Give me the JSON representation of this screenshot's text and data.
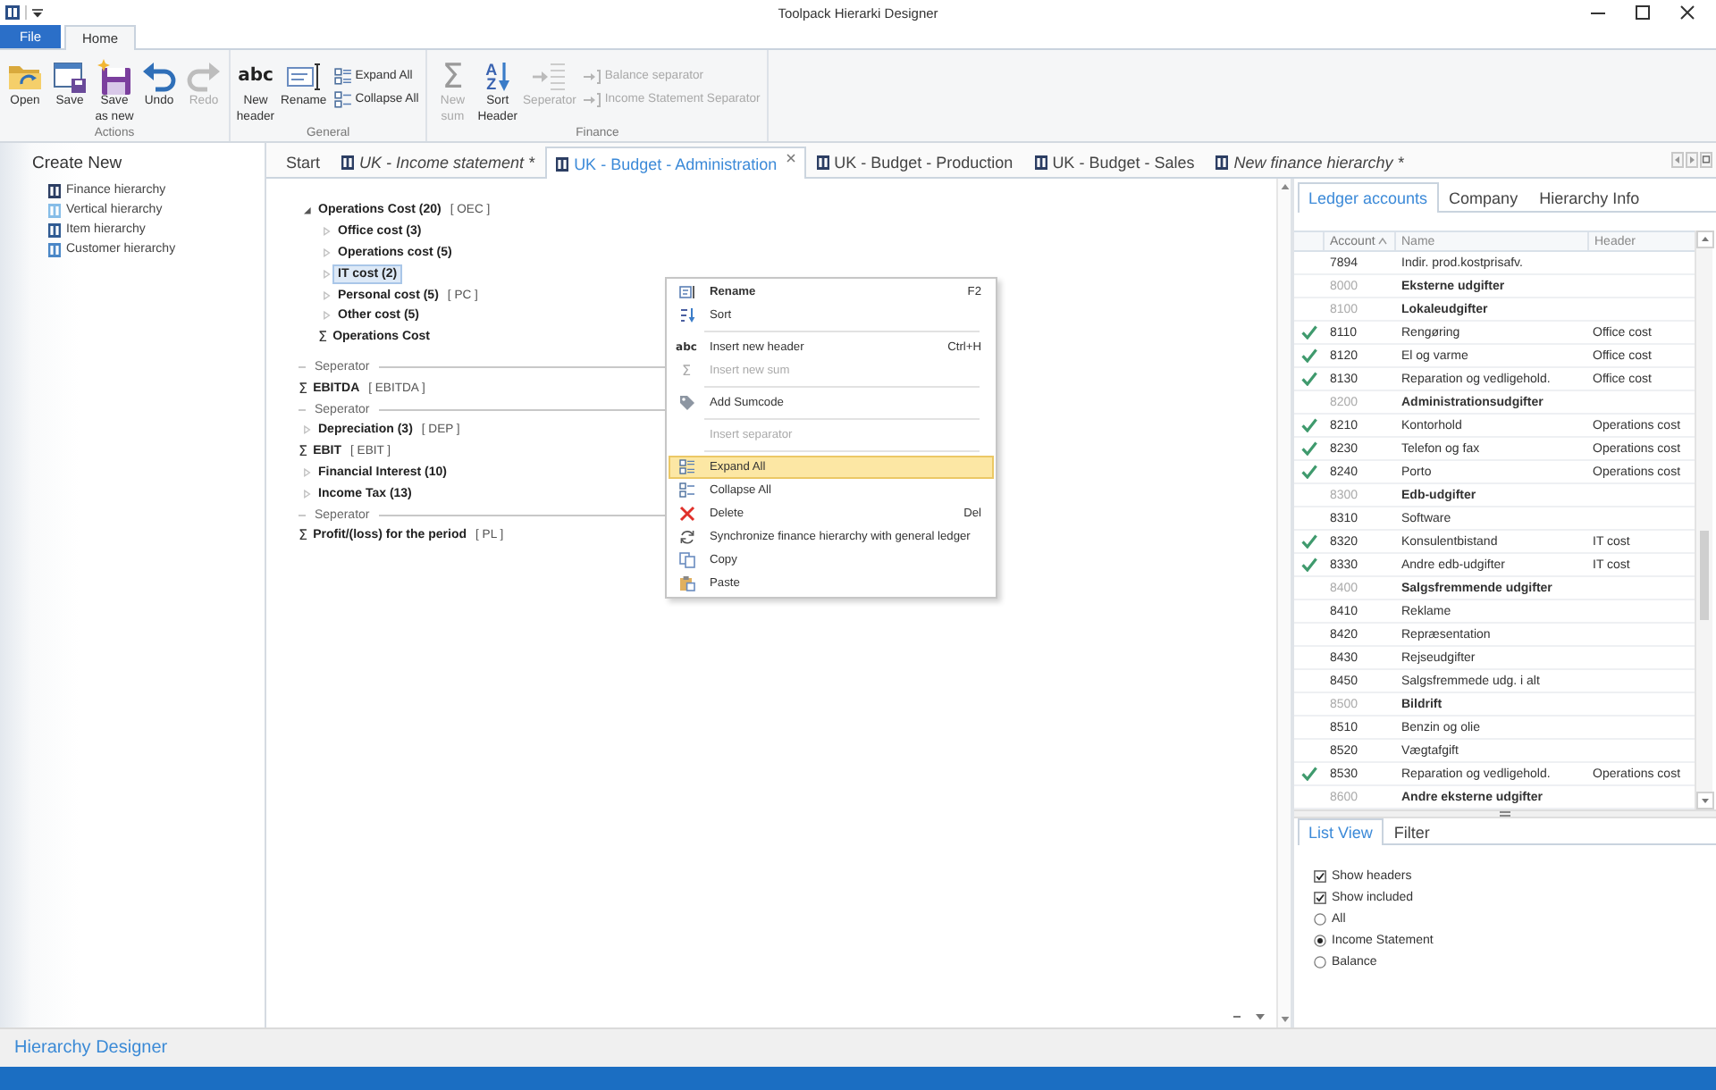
{
  "window": {
    "title": "Toolpack Hierarki Designer"
  },
  "ribbon": {
    "tabs": [
      {
        "label": "File",
        "kind": "file",
        "selected": false
      },
      {
        "label": "Home",
        "kind": "tab",
        "selected": true
      }
    ],
    "groups": [
      {
        "label": "Actions",
        "buttons": [
          {
            "kind": "open",
            "label": "Open",
            "disabled": false
          },
          {
            "kind": "save",
            "label": "Save",
            "disabled": false
          },
          {
            "kind": "saveas",
            "label": "Save\nas new",
            "disabled": false
          },
          {
            "kind": "undo",
            "label": "Undo",
            "disabled": false
          },
          {
            "kind": "redo",
            "label": "Redo",
            "disabled": true
          }
        ]
      },
      {
        "label": "General",
        "buttons": [
          {
            "kind": "header",
            "glyph": "abc",
            "label": "New\nheader",
            "disabled": false
          },
          {
            "kind": "rename",
            "label": "Rename",
            "disabled": false
          },
          {
            "kind": "expand",
            "label": "Expand All",
            "disabled": false
          },
          {
            "kind": "collapse",
            "label": "Collapse All",
            "disabled": false
          }
        ]
      },
      {
        "label": "Finance",
        "buttons": [
          {
            "kind": "sum",
            "glyph": "Σ",
            "label": "New\nsum",
            "disabled": true
          },
          {
            "kind": "sort",
            "glyph": "AZ",
            "label": "Sort\nHeader",
            "disabled": false
          },
          {
            "kind": "separator",
            "label": "Seperator",
            "disabled": true
          },
          {
            "kind": "balance",
            "label": "Balance separator",
            "disabled": true
          },
          {
            "kind": "statement",
            "label": "Income Statement Separator",
            "disabled": true
          }
        ]
      }
    ]
  },
  "sidebar": {
    "title": "Create New",
    "items": [
      {
        "label": "Finance hierarchy",
        "color": "#2c3e63"
      },
      {
        "label": "Vertical hierarchy",
        "color": "#86bde8"
      },
      {
        "label": "Item hierarchy",
        "color": "#2f5b93"
      },
      {
        "label": "Customer hierarchy",
        "color": "#4a87c7"
      }
    ]
  },
  "document_tabs": [
    {
      "kind": "start",
      "label": "Start",
      "selected": false,
      "unsaved": false
    },
    {
      "kind": "document",
      "label": "UK - Income statement *",
      "selected": false,
      "unsaved": true
    },
    {
      "kind": "document",
      "label": "UK - Budget - Administration",
      "selected": true,
      "unsaved": false
    },
    {
      "kind": "document",
      "label": "UK - Budget - Production",
      "selected": false,
      "unsaved": false
    },
    {
      "kind": "document",
      "label": "UK - Budget - Sales",
      "selected": false,
      "unsaved": false
    },
    {
      "kind": "document",
      "label": "New finance hierarchy *",
      "selected": false,
      "unsaved": true
    }
  ],
  "tree": [
    {
      "kind": "group",
      "label": "Operations Cost (20)",
      "code": "[ OEC ]",
      "expanded": true,
      "selected": false,
      "children": [
        {
          "kind": "group",
          "label": "Office cost (3)",
          "expanded": false,
          "selected": false
        },
        {
          "kind": "group",
          "label": "Operations cost (5)",
          "expanded": false,
          "selected": false
        },
        {
          "kind": "group",
          "label": "IT cost (2)",
          "expanded": false,
          "selected": true
        },
        {
          "kind": "group",
          "label": "Personal cost (5)",
          "code": "[ PC ]",
          "expanded": false,
          "selected": false
        },
        {
          "kind": "group",
          "label": "Other cost (5)",
          "expanded": false,
          "selected": false
        },
        {
          "kind": "sum",
          "symbol": "Σ",
          "label": "Operations Cost",
          "selected": false
        }
      ]
    },
    {
      "kind": "separator",
      "label": "Seperator",
      "selected": false
    },
    {
      "kind": "sum",
      "symbol": "Σ",
      "label": "EBITDA",
      "code": "[ EBITDA ]",
      "selected": false
    },
    {
      "kind": "separator",
      "label": "Seperator",
      "selected": false
    },
    {
      "kind": "group",
      "label": "Depreciation (3)",
      "code": "[ DEP ]",
      "expanded": false,
      "selected": false
    },
    {
      "kind": "sum",
      "symbol": "Σ",
      "label": "EBIT",
      "code": "[ EBIT ]",
      "selected": false
    },
    {
      "kind": "group",
      "label": "Financial Interest (10)",
      "expanded": false,
      "selected": false
    },
    {
      "kind": "group",
      "label": "Income Tax (13)",
      "expanded": false,
      "selected": false
    },
    {
      "kind": "separator",
      "label": "Seperator",
      "selected": false
    },
    {
      "kind": "sum",
      "symbol": "Σ",
      "label": "Profit/(loss) for the period",
      "code": "[ PL ]",
      "selected": false
    }
  ],
  "context_menu": [
    {
      "kind": "rename",
      "label": "Rename",
      "shortcut": "F2",
      "default": true,
      "disabled": false,
      "selected": false
    },
    {
      "kind": "sort",
      "label": "Sort",
      "default": false,
      "disabled": false,
      "selected": false
    },
    {
      "kind": "divider"
    },
    {
      "kind": "header",
      "glyph": "abc",
      "label": "Insert new header",
      "shortcut": "Ctrl+H",
      "default": false,
      "disabled": false,
      "selected": false
    },
    {
      "kind": "sum",
      "glyph": "Σ",
      "label": "Insert new sum",
      "default": false,
      "disabled": true,
      "selected": false
    },
    {
      "kind": "divider"
    },
    {
      "kind": "sumcode",
      "label": "Add Sumcode",
      "default": false,
      "disabled": false,
      "selected": false
    },
    {
      "kind": "divider"
    },
    {
      "kind": "blank",
      "label": "Insert separator",
      "default": false,
      "disabled": true,
      "selected": false
    },
    {
      "kind": "divider"
    },
    {
      "kind": "expand",
      "label": "Expand All",
      "default": false,
      "disabled": false,
      "selected": true
    },
    {
      "kind": "collapse",
      "label": "Collapse All",
      "default": false,
      "disabled": false,
      "selected": false
    },
    {
      "kind": "delete",
      "label": "Delete",
      "shortcut": "Del",
      "default": false,
      "disabled": false,
      "selected": false
    },
    {
      "kind": "sync",
      "label": "Synchronize finance hierarchy with general ledger",
      "default": false,
      "disabled": false,
      "selected": false
    },
    {
      "kind": "copy",
      "label": "Copy",
      "default": false,
      "disabled": false,
      "selected": false
    },
    {
      "kind": "paste",
      "label": "Paste",
      "default": false,
      "disabled": false,
      "selected": false
    }
  ],
  "ledger_panel": {
    "tabs": [
      {
        "label": "Ledger accounts",
        "selected": true
      },
      {
        "label": "Company",
        "selected": false
      },
      {
        "label": "Hierarchy Info",
        "selected": false
      }
    ],
    "columns": [
      {
        "label": "Account",
        "sorted": true
      },
      {
        "label": "Name",
        "sorted": false
      },
      {
        "label": "Header",
        "sorted": false
      }
    ],
    "rows": [
      {
        "account": "7894",
        "name": "Indir. prod.kostprisafv.",
        "kind": "account",
        "included": false
      },
      {
        "account": "8000",
        "name": "Eksterne udgifter",
        "kind": "header",
        "included": false
      },
      {
        "account": "8100",
        "name": "Lokaleudgifter",
        "kind": "header",
        "included": false
      },
      {
        "account": "8110",
        "name": "Rengøring",
        "header": "Office cost",
        "kind": "account",
        "included": true
      },
      {
        "account": "8120",
        "name": "El og varme",
        "header": "Office cost",
        "kind": "account",
        "included": true
      },
      {
        "account": "8130",
        "name": "Reparation og vedligehold.",
        "header": "Office cost",
        "kind": "account",
        "included": true
      },
      {
        "account": "8200",
        "name": "Administrationsudgifter",
        "kind": "header",
        "included": false
      },
      {
        "account": "8210",
        "name": "Kontorhold",
        "header": "Operations cost",
        "kind": "account",
        "included": true
      },
      {
        "account": "8230",
        "name": "Telefon og fax",
        "header": "Operations cost",
        "kind": "account",
        "included": true
      },
      {
        "account": "8240",
        "name": "Porto",
        "header": "Operations cost",
        "kind": "account",
        "included": true
      },
      {
        "account": "8300",
        "name": "Edb-udgifter",
        "kind": "header",
        "included": false
      },
      {
        "account": "8310",
        "name": "Software",
        "kind": "account",
        "included": false
      },
      {
        "account": "8320",
        "name": "Konsulentbistand",
        "header": "IT cost",
        "kind": "account",
        "included": true
      },
      {
        "account": "8330",
        "name": "Andre edb-udgifter",
        "header": "IT cost",
        "kind": "account",
        "included": true
      },
      {
        "account": "8400",
        "name": "Salgsfremmende udgifter",
        "kind": "header",
        "included": false
      },
      {
        "account": "8410",
        "name": "Reklame",
        "kind": "account",
        "included": false
      },
      {
        "account": "8420",
        "name": "Repræsentation",
        "kind": "account",
        "included": false
      },
      {
        "account": "8430",
        "name": "Rejseudgifter",
        "kind": "account",
        "included": false
      },
      {
        "account": "8450",
        "name": "Salgsfremmede udg. i alt",
        "kind": "account",
        "included": false
      },
      {
        "account": "8500",
        "name": "Bildrift",
        "kind": "header",
        "included": false
      },
      {
        "account": "8510",
        "name": "Benzin og olie",
        "kind": "account",
        "included": false
      },
      {
        "account": "8520",
        "name": "Vægtafgift",
        "kind": "account",
        "included": false
      },
      {
        "account": "8530",
        "name": "Reparation og vedligehold.",
        "header": "Operations cost",
        "kind": "account",
        "included": true
      },
      {
        "account": "8600",
        "name": "Andre eksterne udgifter",
        "kind": "header",
        "included": false
      }
    ]
  },
  "list_panel": {
    "tabs": [
      {
        "label": "List View",
        "selected": true
      },
      {
        "label": "Filter",
        "selected": false
      }
    ],
    "options": [
      {
        "kind": "checkbox",
        "label": "Show headers",
        "checked": true
      },
      {
        "kind": "checkbox",
        "label": "Show included",
        "checked": true
      },
      {
        "kind": "radio",
        "label": "All",
        "selected": false
      },
      {
        "kind": "radio",
        "label": "Income Statement",
        "selected": true
      },
      {
        "kind": "radio",
        "label": "Balance",
        "selected": false
      }
    ]
  },
  "footer": {
    "title": "Hierarchy Designer"
  }
}
